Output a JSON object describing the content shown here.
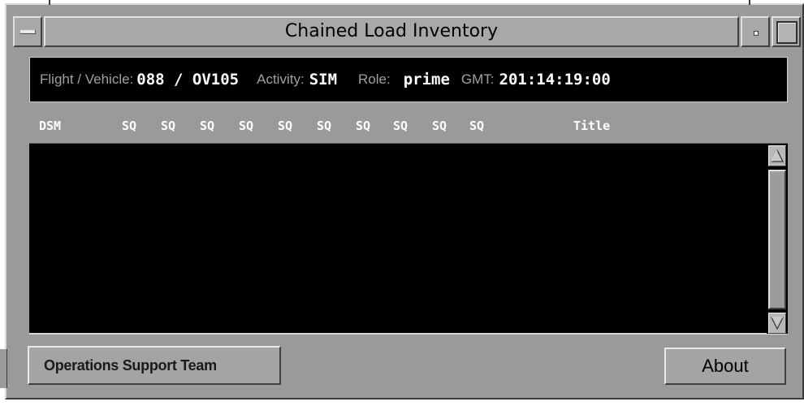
{
  "window": {
    "title": "Chained Load Inventory"
  },
  "info": {
    "flight_vehicle_label": "Flight / Vehicle:",
    "flight_vehicle_value": "088 / OV105",
    "activity_label": "Activity:",
    "activity_value": "SIM",
    "role_label": "Role:",
    "role_value": "prime",
    "gmt_label": "GMT:",
    "gmt_value": "201:14:19:00"
  },
  "columns": {
    "dsm": "DSM",
    "sq": [
      "SQ",
      "SQ",
      "SQ",
      "SQ",
      "SQ",
      "SQ",
      "SQ",
      "SQ",
      "SQ",
      "SQ"
    ],
    "title": "Title"
  },
  "list": {
    "rows": []
  },
  "buttons": {
    "ost": "Operations Support Team",
    "about": "About"
  },
  "icons": {
    "window_menu": "window-menu-icon",
    "minimize": "minimize-icon",
    "maximize": "maximize-icon",
    "scroll_up": "scroll-up-arrow-icon",
    "scroll_down": "scroll-down-arrow-icon"
  }
}
